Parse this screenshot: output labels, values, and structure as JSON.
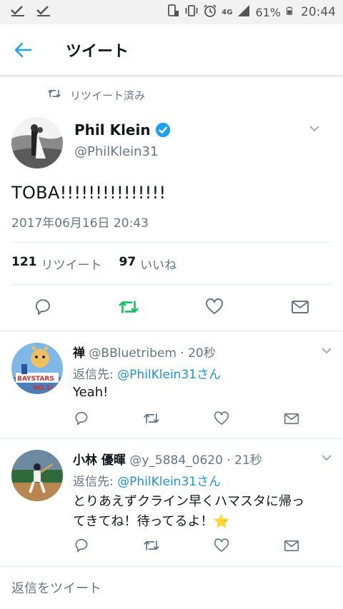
{
  "status_bar": {
    "battery_percent": "61%",
    "time": "20:44",
    "network": "4G"
  },
  "header": {
    "title": "ツイート"
  },
  "retweet_label": "リツイート済み",
  "tweet": {
    "name": "Phil Klein",
    "handle": "@PhilKlein31",
    "text": "TOBA!!!!!!!!!!!!!!!",
    "timestamp": "2017年06月16日 20:43",
    "retweet_count": "121",
    "retweet_label": "リツイート",
    "like_count": "97",
    "like_label": "いいね"
  },
  "replies": [
    {
      "name": "禅",
      "handle_time": "@BBluetribem · 20秒",
      "reply_to_prefix": "返信先: ",
      "reply_to": "@PhilKlein31さん",
      "text_lines": [
        "Yeah!"
      ]
    },
    {
      "name": "小林 優暉",
      "handle_time": "@y_5884_0620 · 21秒",
      "reply_to_prefix": "返信先: ",
      "reply_to": "@PhilKlein31さん",
      "text_lines": [
        "とりあえずクライン早くハマスタに帰っ",
        "てきてね！待ってるよ！⭐"
      ]
    }
  ],
  "reply_prompt": "返信をツイート",
  "colors": {
    "accent": "#1da1f2",
    "retweeted": "#17bf63",
    "secondary_text": "#657786"
  }
}
